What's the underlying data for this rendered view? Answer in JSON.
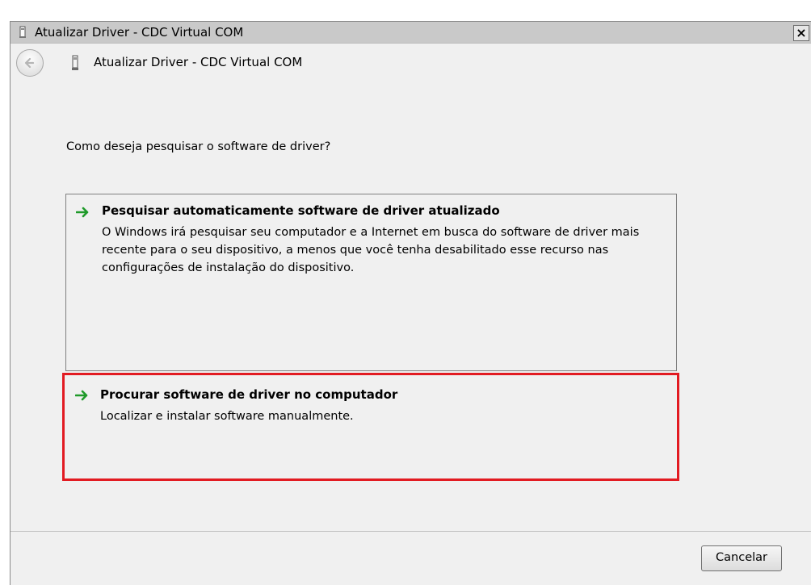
{
  "window": {
    "title": "Atualizar Driver -  CDC Virtual COM",
    "close_label": "×"
  },
  "nav": {
    "title": "Atualizar Driver -  CDC Virtual COM"
  },
  "main": {
    "question": "Como deseja pesquisar o software de driver?",
    "options": [
      {
        "title": "Pesquisar automaticamente software de driver atualizado",
        "description": "O Windows irá pesquisar seu computador e a Internet em busca do software de driver mais recente para o seu dispositivo, a menos que você tenha desabilitado esse recurso nas configurações de instalação do dispositivo."
      },
      {
        "title": "Procurar software de driver no computador",
        "description": "Localizar e instalar software manualmente.",
        "highlighted": true
      }
    ]
  },
  "footer": {
    "cancel_label": "Cancelar"
  },
  "colors": {
    "highlight_border": "#e21b22",
    "arrow_green": "#1f9a2a",
    "dialog_background": "#f0f0f0"
  },
  "icons": {
    "title": "device-icon",
    "back": "back-arrow-icon",
    "option_arrow": "green-arrow-icon"
  }
}
